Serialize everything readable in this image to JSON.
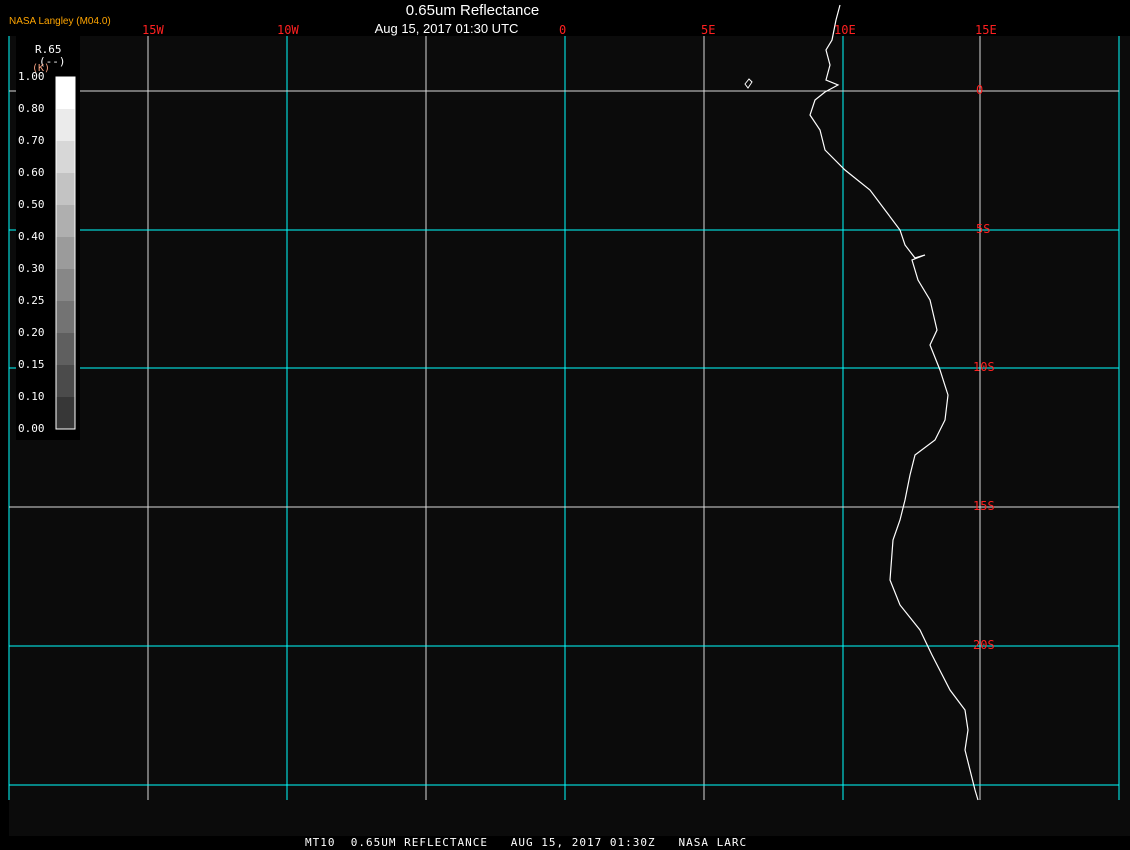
{
  "header": {
    "credit": "NASA Langley (M04.0)",
    "title": "0.65um Reflectance",
    "subtitle": "Aug 15, 2017 01:30 UTC"
  },
  "footer": {
    "text": "MT10  0.65UM REFLECTANCE   AUG 15, 2017 01:30Z   NASA LARC"
  },
  "longitude_labels": [
    "15W",
    "10W",
    "0",
    "5E",
    "10E",
    "15E"
  ],
  "latitude_labels": [
    "0",
    "5S",
    "10S",
    "15S",
    "20S"
  ],
  "legend": {
    "variable": "R.65",
    "unit": "(--)",
    "unit_alt": "(K)",
    "ticks": [
      "1.00",
      "0.80",
      "0.70",
      "0.60",
      "0.50",
      "0.40",
      "0.30",
      "0.25",
      "0.20",
      "0.15",
      "0.10",
      "0.00"
    ]
  },
  "colors": {
    "background": "#0b0b0b",
    "grid_cyan": "#00ffff",
    "grid_white": "#d8d8d8",
    "label_red": "#ff2020",
    "credit_orange": "#ffa500",
    "coastline": "#ffffff"
  }
}
